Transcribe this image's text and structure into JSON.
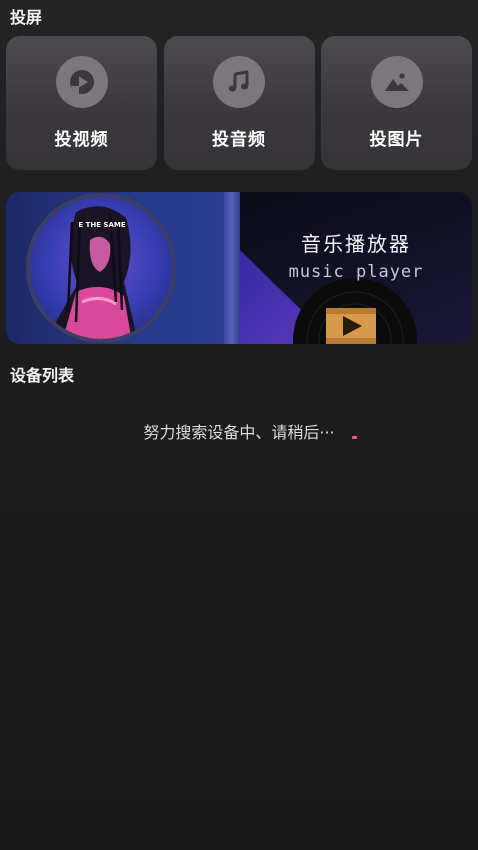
{
  "cast_section": {
    "title": "投屏",
    "cards": [
      {
        "label": "投视频",
        "icon": "video-play-icon"
      },
      {
        "label": "投音频",
        "icon": "music-note-icon"
      },
      {
        "label": "投图片",
        "icon": "image-icon"
      }
    ]
  },
  "banner": {
    "title": "音乐播放器",
    "subtitle": "music player",
    "album_text": "E THE SAME"
  },
  "devices_section": {
    "title": "设备列表",
    "status": "努力搜索设备中、请稍后···"
  },
  "colors": {
    "background": "#1e1e1e",
    "card": "#3f3d41",
    "icon_circle": "#7b777c",
    "accent_dot": "#ff4f86"
  }
}
